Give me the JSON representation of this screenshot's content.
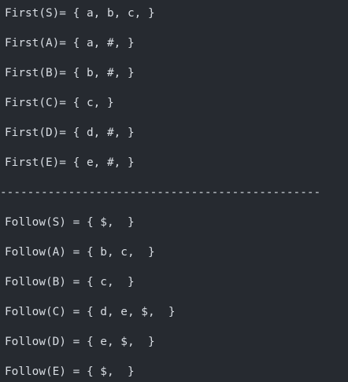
{
  "first_sets": [
    "First(S)= { a, b, c, }",
    "First(A)= { a, #, }",
    "First(B)= { b, #, }",
    "First(C)= { c, }",
    "First(D)= { d, #, }",
    "First(E)= { e, #, }"
  ],
  "separator": "-----------------------------------------------",
  "follow_sets": [
    "Follow(S) = { $,  }",
    "Follow(A) = { b, c,  }",
    "Follow(B) = { c,  }",
    "Follow(C) = { d, e, $,  }",
    "Follow(D) = { e, $,  }",
    "Follow(E) = { $,  }"
  ],
  "colors": {
    "background": "#262a30",
    "text": "#d8dde3"
  }
}
